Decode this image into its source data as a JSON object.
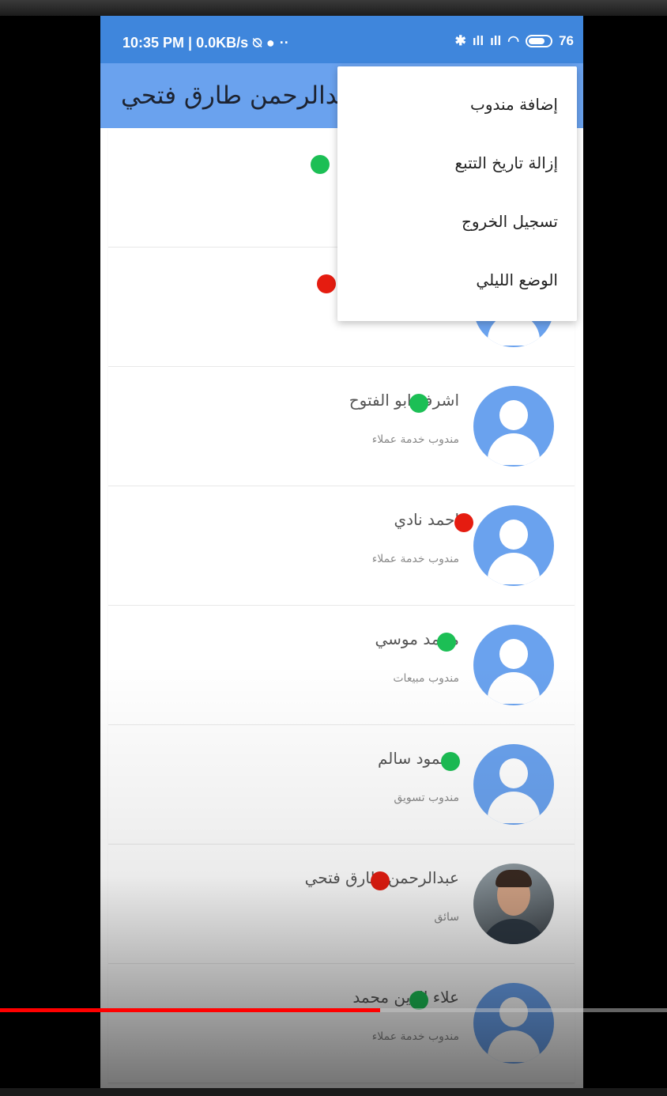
{
  "status_bar": {
    "time_info": "10:35 PM | 0.0KB/s",
    "battery": "76"
  },
  "app_bar": {
    "title": "عبدالرحمن طارق فتحي"
  },
  "menu": {
    "items": [
      {
        "label": "إضافة مندوب"
      },
      {
        "label": "إزالة تاريخ التتبع"
      },
      {
        "label": "تسجيل الخروج"
      },
      {
        "label": "الوضع الليلي"
      }
    ]
  },
  "agents": [
    {
      "name": "",
      "role": "",
      "status": "online"
    },
    {
      "name": "",
      "role": "",
      "status": "offline"
    },
    {
      "name": "اشرف ابو الفتوح",
      "role": "مندوب خدمة عملاء",
      "status": "online"
    },
    {
      "name": "احمد نادي",
      "role": "مندوب خدمة عملاء",
      "status": "offline"
    },
    {
      "name": "محمد موسي",
      "role": "مندوب مبيعات",
      "status": "online"
    },
    {
      "name": "محمود سالم",
      "role": "مندوب تسويق",
      "status": "online"
    },
    {
      "name": "عبدالرحمن طارق فتحي",
      "role": "سائق",
      "status": "offline",
      "avatar": "photo"
    },
    {
      "name": "علاء الدين محمد",
      "role": "مندوب خدمة عملاء",
      "status": "online"
    }
  ],
  "video_progress": 0.57,
  "colors": {
    "primary": "#3f86dc",
    "app_bar": "#6aa2ee",
    "online": "#1cbf55",
    "offline": "#e51c10",
    "progress": "#ff0000"
  }
}
